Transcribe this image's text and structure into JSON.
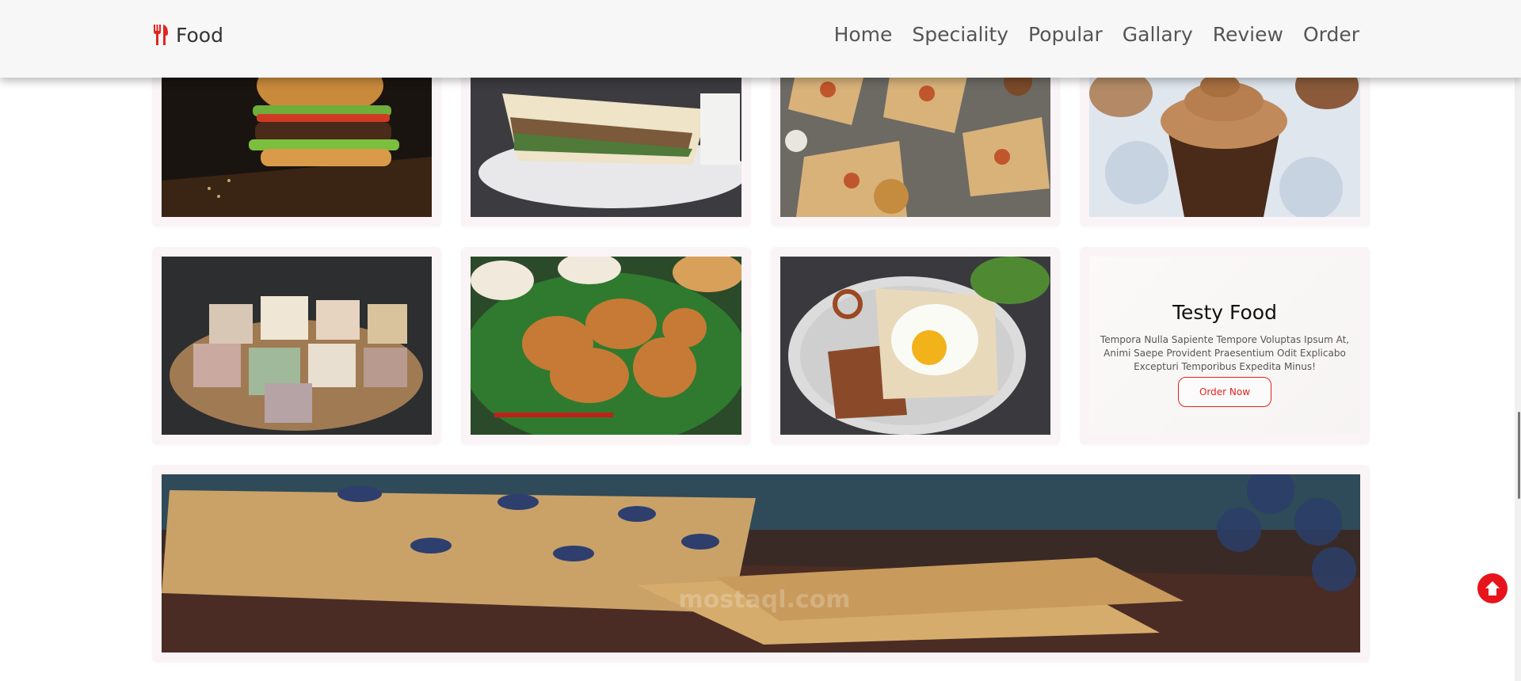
{
  "header": {
    "brand": "Food",
    "nav": [
      "Home",
      "Speciality",
      "Popular",
      "Gallary",
      "Review",
      "Order"
    ]
  },
  "gallery": {
    "images": [
      "burger",
      "sandwich",
      "wraps",
      "cupcake",
      "soap-cubes",
      "fried-chicken",
      "egg-toast",
      "oat-bars"
    ],
    "promo": {
      "title": "Testy Food",
      "text": "Tempora Nulla Sapiente Tempore Voluptas Ipsum At, Animi Saepe Provident Praesentium Odit Explicabo Excepturi Temporibus Expedita Minus!",
      "button": "Order Now"
    }
  },
  "watermark": "mostaql.com",
  "colors": {
    "accent": "#e1241f",
    "header_bg": "#f7f7f7",
    "card_bg": "#faf4f6"
  }
}
